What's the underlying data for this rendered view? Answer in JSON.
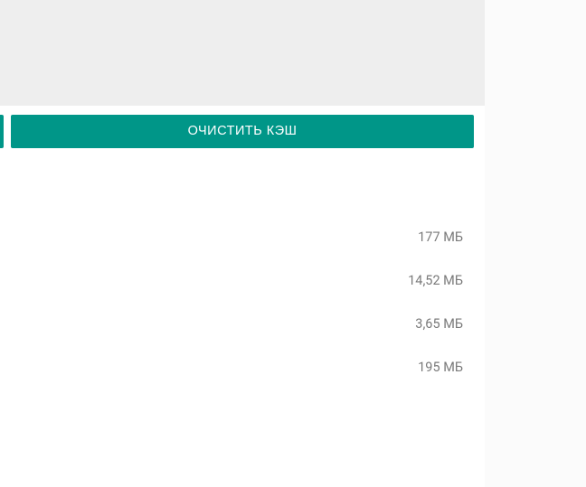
{
  "actions": {
    "clear_cache_label": "ОЧИСТИТЬ КЭШ"
  },
  "storage": {
    "rows": [
      {
        "value": "177 МБ"
      },
      {
        "value": "14,52 МБ"
      },
      {
        "value": "3,65 МБ"
      },
      {
        "value": "195 МБ"
      }
    ]
  }
}
